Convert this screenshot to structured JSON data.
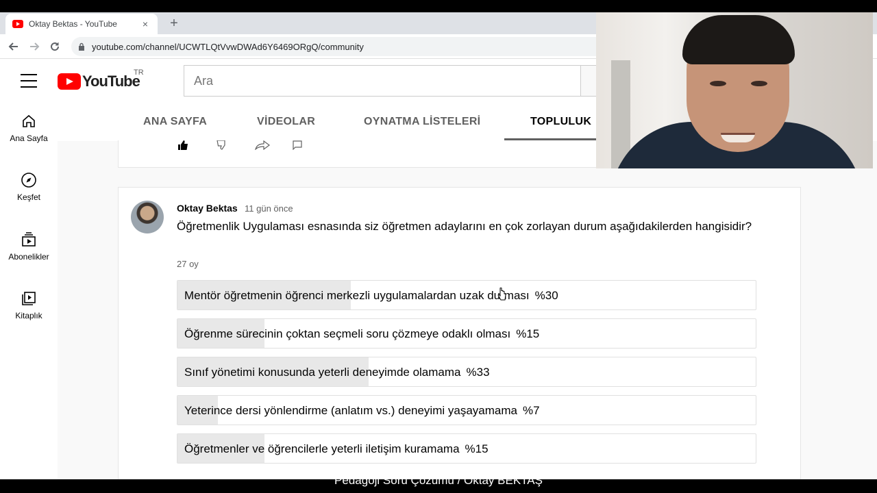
{
  "browser": {
    "tab_title": "Oktay Bektas - YouTube",
    "tab_close": "×",
    "new_tab": "+",
    "url": "youtube.com/channel/UCWTLQtVvwDWAd6Y6469ORgQ/community"
  },
  "masthead": {
    "logo_text": "YouTube",
    "region": "TR",
    "search_placeholder": "Ara"
  },
  "guide": {
    "items": [
      {
        "label": "Ana Sayfa",
        "icon": "home-icon"
      },
      {
        "label": "Keşfet",
        "icon": "compass-icon"
      },
      {
        "label": "Abonelikler",
        "icon": "subscriptions-icon"
      },
      {
        "label": "Kitaplık",
        "icon": "library-icon"
      }
    ]
  },
  "channel_tabs": [
    {
      "label": "ANA SAYFA",
      "active": false
    },
    {
      "label": "VİDEOLAR",
      "active": false
    },
    {
      "label": "OYNATMA LİSTELERİ",
      "active": false
    },
    {
      "label": "TOPLULUK",
      "active": true
    }
  ],
  "post": {
    "author": "Oktay Bektas",
    "time": "11 gün önce",
    "question": "Öğretmenlik Uygulaması esnasında siz öğretmen adaylarını en çok zorlayan durum aşağıdakilerden hangisidir?",
    "votes": "27 oy",
    "options": [
      {
        "text": "Mentör öğretmenin öğrenci merkezli uygulamalardan uzak durması",
        "pct_label": "%30",
        "pct": 30
      },
      {
        "text": "Öğrenme sürecinin çoktan seçmeli soru çözmeye odaklı olması",
        "pct_label": "%15",
        "pct": 15
      },
      {
        "text": "Sınıf yönetimi konusunda yeterli deneyimde olamama",
        "pct_label": "%33",
        "pct": 33
      },
      {
        "text": "Yeterince dersi yönlendirme (anlatım vs.) deneyimi yaşayamama",
        "pct_label": "%7",
        "pct": 7
      },
      {
        "text": "Öğretmenler ve öğrencilerle yeterli iletişim kuramama",
        "pct_label": "%15",
        "pct": 15
      }
    ]
  },
  "caption": "Pedagoji Soru Çözümü / Oktay BEKTAŞ",
  "colors": {
    "youtube_red": "#ff0000",
    "poll_fill": "#e8e8e8",
    "text_primary": "#030303",
    "text_secondary": "#606060"
  }
}
